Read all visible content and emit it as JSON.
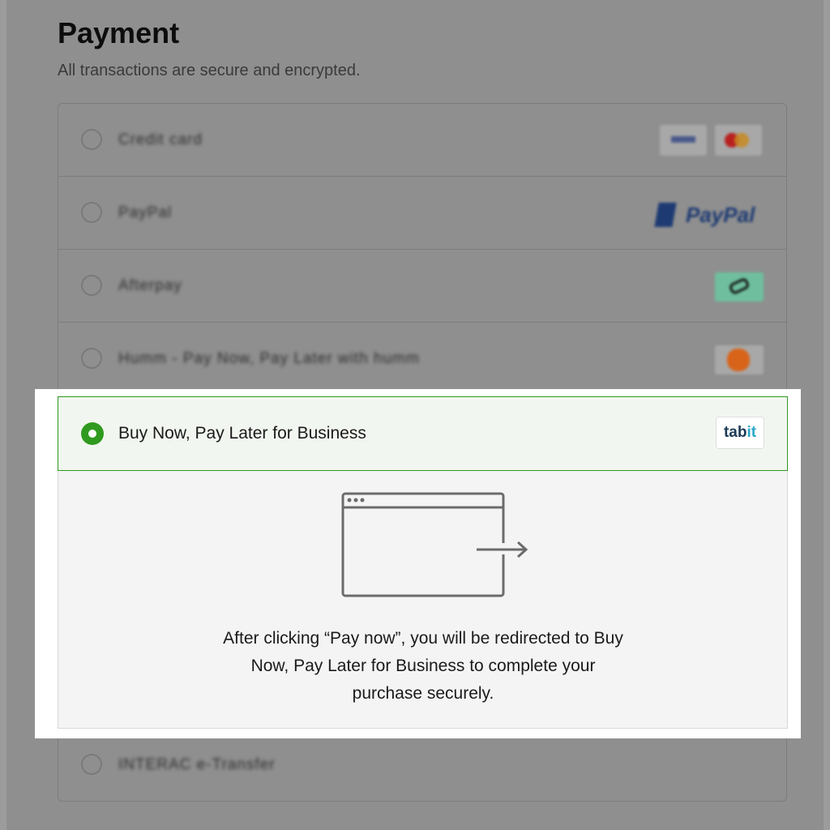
{
  "header": {
    "title": "Payment",
    "subtitle": "All transactions are secure and encrypted."
  },
  "payment_methods": [
    {
      "label": "Credit card",
      "icons": [
        "visa-logo",
        "mastercard-logo"
      ],
      "selected": false
    },
    {
      "label": "PayPal",
      "logo_text": "PayPal",
      "icons": [
        "paypal-logo"
      ],
      "selected": false
    },
    {
      "label": "Afterpay",
      "icons": [
        "afterpay-logo"
      ],
      "selected": false
    },
    {
      "label": "Humm - Pay Now, Pay Later with humm",
      "icons": [
        "humm-logo"
      ],
      "selected": false
    },
    {
      "label": "Buy Now, Pay Later for Business",
      "icons": [
        "tabit-logo"
      ],
      "selected": true
    },
    {
      "label": "INTERAC e-Transfer",
      "icons": [],
      "selected": false
    }
  ],
  "selected_method": {
    "logo_text_a": "tab",
    "logo_text_b": "it",
    "redirect_text_lines": [
      "After clicking “Pay now”, you will be redirected to Buy",
      "Now, Pay Later for Business to complete your",
      "purchase securely."
    ]
  },
  "colors": {
    "accent": "#2f9a1f",
    "overlay": "#8f8f8f",
    "selected_bg": "#f2f6f0"
  }
}
